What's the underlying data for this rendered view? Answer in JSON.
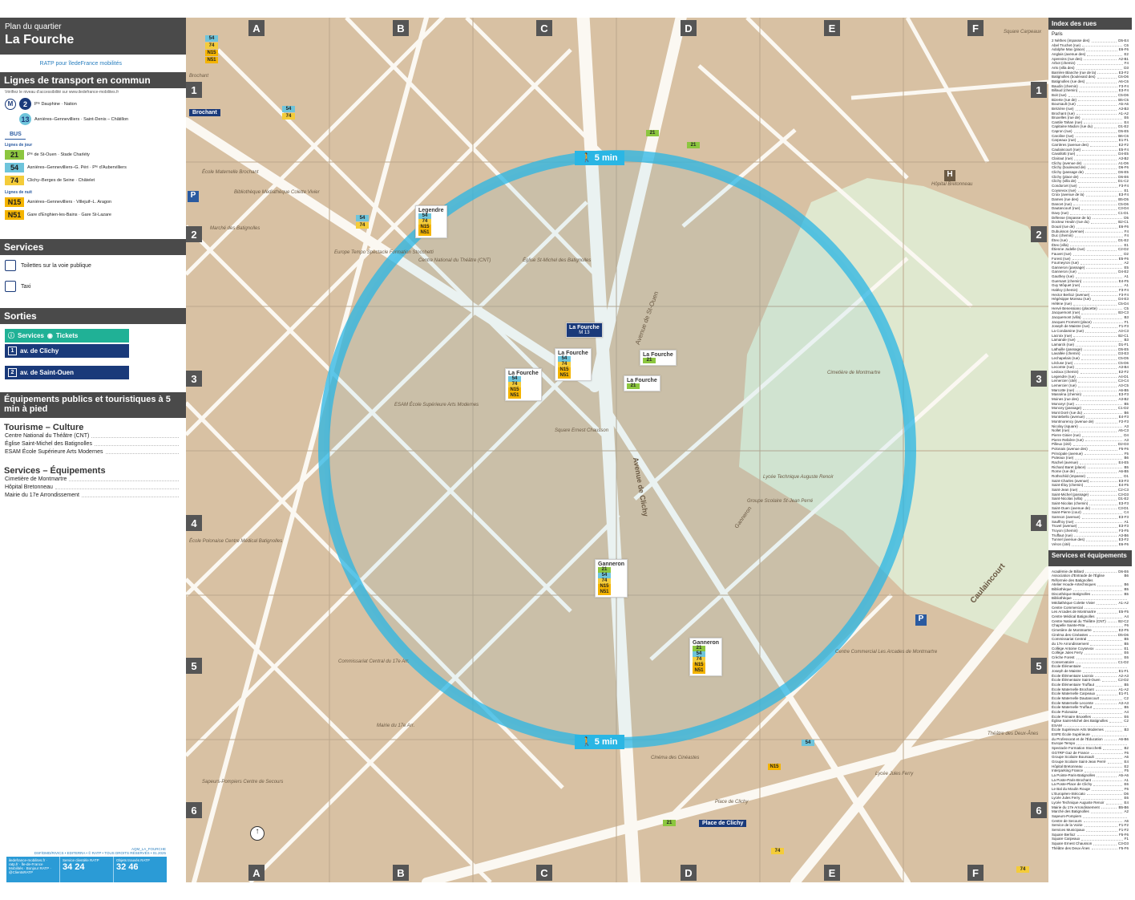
{
  "header": {
    "subtitle": "Plan du quartier",
    "title": "La Fourche",
    "logo_text": "RATP pour îledeFrance mobilités"
  },
  "transport": {
    "heading": "Lignes de transport en commun",
    "note": "Vérifiez le niveau d'accessibilité sur www.iledefrance-mobilites.fr",
    "metro_symbol": "M",
    "metro": [
      {
        "line": "2",
        "color": "#1a3a7a",
        "dest": "Pᵗᵉ Dauphine · Nation"
      },
      {
        "line": "13",
        "color": "#6ec4db",
        "dest": "Asnières–Gennevilliers · Saint-Denis – Châtillon"
      }
    ],
    "bus_label": "BUS",
    "day_label": "Lignes de jour",
    "night_label": "Lignes de nuit",
    "bus_day": [
      {
        "line": "21",
        "color": "#8cc63f",
        "dest": "Pᵗᵉ de St-Ouen · Stade Charléty"
      },
      {
        "line": "54",
        "color": "#6ec4db",
        "dest": "Asnières–Gennevilliers–G. Péri · Pᵗᵉ d'Aubervilliers"
      },
      {
        "line": "74",
        "color": "#f4cc3a",
        "dest": "Clichy–Berges de Seine · Châtelet"
      }
    ],
    "bus_night": [
      {
        "line": "N15",
        "color": "#f4b400",
        "dest": "Asnières–Gennevilliers · Villejuif–L. Aragon"
      },
      {
        "line": "N51",
        "color": "#f4b400",
        "dest": "Gare d'Enghien-les-Bains · Gare St-Lazare"
      }
    ]
  },
  "services": {
    "heading": "Services",
    "items": [
      {
        "label": "Toilettes sur la voie publique"
      },
      {
        "label": "Taxi"
      }
    ]
  },
  "exits": {
    "heading": "Sorties",
    "services_label": "Services",
    "tickets_label": "Tickets",
    "items": [
      {
        "num": "1",
        "label": "av. de Clichy"
      },
      {
        "num": "2",
        "label": "av. de Saint-Ouen"
      }
    ]
  },
  "facilities": {
    "heading": "Équipements publics et touristiques à 5 min à pied",
    "categories": [
      {
        "title": "Tourisme – Culture",
        "items": [
          "Centre National du Théâtre (CNT)",
          "Église Saint-Michel des Batignolles",
          "ESAM École Supérieure Arts Modernes"
        ]
      },
      {
        "title": "Services – Équipements",
        "items": [
          "Cimetière de Montmartre",
          "Hôpital Bretonneau",
          "Mairie du 17e Arrondissement"
        ]
      }
    ]
  },
  "footer": {
    "ref": "AQM_LA_FOURCHE",
    "copyright": "DSF/DMD/RIVICS • EDITERRA • © RATP • TOUS DROITS RÉSERVÉS • 01.2025",
    "col1": "iledefrance-mobilites.fr · ratp.fr · Île-de-France Mobilités · Bonjour RATP · @ClientsRATP",
    "col2_title": "Service clientèle RATP",
    "col2_num": "34 24",
    "col3_title": "Objets trouvés RATP",
    "col3_num": "32 46"
  },
  "map": {
    "columns": [
      "A",
      "B",
      "C",
      "D",
      "E",
      "F"
    ],
    "rows": [
      "1",
      "2",
      "3",
      "4",
      "5",
      "6"
    ],
    "walk_label": "5 min",
    "station_main": "La Fourche",
    "metro_symbol": "M",
    "metro_line": "13",
    "stations": [
      {
        "name": "Legendre",
        "lines": [
          "54",
          "74",
          "N15",
          "N51"
        ]
      },
      {
        "name": "La Fourche",
        "lines": [
          "54",
          "74",
          "N15",
          "N51"
        ]
      },
      {
        "name": "La Fourche",
        "lines": [
          "54",
          "74",
          "N15",
          "N51"
        ]
      },
      {
        "name": "La Fourche",
        "lines": [
          "21"
        ]
      },
      {
        "name": "La Fourche",
        "lines": [
          "21"
        ]
      },
      {
        "name": "Ganneron",
        "lines": [
          "21",
          "54",
          "74",
          "N15",
          "N51"
        ]
      },
      {
        "name": "Ganneron",
        "lines": [
          "21",
          "54",
          "74",
          "N15",
          "N51"
        ]
      }
    ],
    "labels": [
      "Brochant",
      "École Maternelle Brochant",
      "Bibliothèque Médiathèque Colette Vivier",
      "Marché des Batignolles",
      "Europe Tempo Spectacle Formation Stocchetti",
      "Centre National du Théâtre (CNT)",
      "Église St-Michel des Batignolles",
      "Cimetière de Montmartre",
      "ESAM École Supérieure Arts Modernes",
      "Square Ernest Chausson",
      "Groupe Scolaire St-Jean Perré",
      "Centre Commercial Les Arcades de Montmartre",
      "Hôpital Bretonneau",
      "Commissariat Central du 17e Arr.",
      "Mairie du 17e Arr.",
      "Place de Clichy",
      "Lycée Jules Ferry",
      "Théâtre des Deux-Ânes",
      "Cinéma des Cinéastes",
      "Sapeurs-Pompiers Centre de Secours",
      "Square Carpeaux",
      "École Polonaise Centre Médical Batignolles",
      "Avenue de Clichy",
      "Avenue de St-Ouen",
      "Caulaincourt",
      "Ganneron",
      "Lycée Technique Auguste Renoir"
    ],
    "metro_labels": [
      "Brochant",
      "Place de Clichy"
    ]
  },
  "index": {
    "heading": "Index des rues",
    "city": "Paris",
    "streets": [
      [
        "2 Nèthes (impasse des)",
        "D5-E4"
      ],
      [
        "Abel Truchet (rue)",
        "C6"
      ],
      [
        "Adolphe Max (place)",
        "E6-F6"
      ],
      [
        "Anglais (avenue des)",
        "E2"
      ],
      [
        "Apennins (rue des)",
        "A2-B1"
      ],
      [
        "Arbot (chemin)",
        "F4"
      ],
      [
        "Arts (villa des)",
        "D3"
      ],
      [
        "Barrière Blanche (rue de la)",
        "E3-F2"
      ],
      [
        "Batignolles (boulevard des)",
        "C6-D6"
      ],
      [
        "Batignolles (rue des)",
        "A6-C6"
      ],
      [
        "Baudin (chemin)",
        "F3-F4"
      ],
      [
        "Billaud (chemin)",
        "E3-F4"
      ],
      [
        "Boit (rue)",
        "C5-D6"
      ],
      [
        "Bizerte (rue de)",
        "B5-C5"
      ],
      [
        "Boursault (rue)",
        "A5-A6"
      ],
      [
        "Brézière (rue)",
        "A3-B3"
      ],
      [
        "Brochant (rue)",
        "A1-A2"
      ],
      [
        "Bruxelles (rue de)",
        "E6"
      ],
      [
        "Cantile Tahan (rue)",
        "E4"
      ],
      [
        "Capitaine Madon (rue du)",
        "D1-E2"
      ],
      [
        "Capron (rue)",
        "D5-E5"
      ],
      [
        "Caroline (rue)",
        "B6-C6"
      ],
      [
        "Carpeaux (rue)",
        "E1-F1"
      ],
      [
        "Carrières (avenue des)",
        "E2-F2"
      ],
      [
        "Caulaincourt (rue)",
        "E5-F4"
      ],
      [
        "Cavallotti (rue)",
        "D4-E5"
      ],
      [
        "Clairaut (rue)",
        "A3-B2"
      ],
      [
        "Clichy (avenue de)",
        "A1-D6"
      ],
      [
        "Clichy (boulevard de)",
        "D6-F6"
      ],
      [
        "Clichy (passage de)",
        "D6-E5"
      ],
      [
        "Clichy (place de)",
        "D6-E6"
      ],
      [
        "Clichy (villa de)",
        "D1-C2"
      ],
      [
        "Condorcet (rue)",
        "F3-F4"
      ],
      [
        "Coysevox (rue)",
        "E1"
      ],
      [
        "Croix (avenue de la)",
        "E3-F4"
      ],
      [
        "Dames (rue des)",
        "B5-D5"
      ],
      [
        "Dancet (rue)",
        "C5-D6"
      ],
      [
        "Dautancourt (rue)",
        "C3-D4"
      ],
      [
        "Davy (rue)",
        "C1-D1"
      ],
      [
        "Défense (impasse de la)",
        "D5"
      ],
      [
        "Docteur Heulin (rue du)",
        "B2-C1"
      ],
      [
        "Doual (rue de)",
        "E6-F6"
      ],
      [
        "Dubuisson (avenue)",
        "F4"
      ],
      [
        "Duc (chemin)",
        "F4"
      ],
      [
        "Étex (rue)",
        "D1-E2"
      ],
      [
        "Étex (villa)",
        "E1"
      ],
      [
        "Étienne Jodelle (rue)",
        "C2-D2"
      ],
      [
        "Fauvet (rue)",
        "D2"
      ],
      [
        "Forest (rue)",
        "E5-F6"
      ],
      [
        "Fourneyron (rue)",
        "A2"
      ],
      [
        "Ganneron (passage)",
        "E5"
      ],
      [
        "Ganneron (rue)",
        "D4-E2"
      ],
      [
        "Gauthey (rue)",
        "A1"
      ],
      [
        "Guersant (chemin)",
        "E4-F5"
      ],
      [
        "Guy Môquet (rue)",
        "A1"
      ],
      [
        "Halévy (chemin)",
        "F3-F4"
      ],
      [
        "Hector Berlioz (avenue)",
        "F3-F4"
      ],
      [
        "Hégésippe Moreau (rue)",
        "D4-E3"
      ],
      [
        "Hélène (rue)",
        "C5-D4"
      ],
      [
        "Hervé Benessiano (placette)",
        "C5"
      ],
      [
        "Jacquemont (rue)",
        "B3-C3"
      ],
      [
        "Jacquemont (villa)",
        "B3"
      ],
      [
        "Jacques Froment (place)",
        "F1"
      ],
      [
        "Joseph de Maistre (rue)",
        "F1-F3"
      ],
      [
        "La Condamine (rue)",
        "A3-C3"
      ],
      [
        "Lacroix (rue)",
        "B2-C1"
      ],
      [
        "Lamande (rue)",
        "B3"
      ],
      [
        "Lamarck (rue)",
        "D1-F1"
      ],
      [
        "Lathuille (passage)",
        "D5-E5"
      ],
      [
        "Lavallée (chemin)",
        "D3-E3"
      ],
      [
        "Lechapelais (rue)",
        "C5-D5"
      ],
      [
        "Lécluse (rue)",
        "C5-D6"
      ],
      [
        "Lecomte (rue)",
        "A3-B4"
      ],
      [
        "Ledoux (chemin)",
        "E2-F2"
      ],
      [
        "Legendre (rue)",
        "A4-D1"
      ],
      [
        "Lemercier (cité)",
        "C3-C4"
      ],
      [
        "Lemercier (rue)",
        "A3-C5"
      ],
      [
        "Marcotte (rue)",
        "A6-B5"
      ],
      [
        "Masséna (chemin)",
        "E3-F3"
      ],
      [
        "Moines (rue des)",
        "A3-B2"
      ],
      [
        "Monceyr (rue)",
        "B5"
      ],
      [
        "Moncey (passage)",
        "C1-D2"
      ],
      [
        "Mont Doré (rue du)",
        "B6"
      ],
      [
        "Montebello (avenue)",
        "E4-F3"
      ],
      [
        "Montmorency (avenue de)",
        "F2-F3"
      ],
      [
        "Nicolay (square)",
        "A3"
      ],
      [
        "Nollet (rue)",
        "A5-C3"
      ],
      [
        "Pierre Ginier (rue)",
        "D4"
      ],
      [
        "Pierre Rebière (rue)",
        "A3"
      ],
      [
        "Pilleux (cité)",
        "D2-D3"
      ],
      [
        "Polonais (avenue des)",
        "F5-F6"
      ],
      [
        "Principale (avenue)",
        "F5"
      ],
      [
        "Puteaux (rue)",
        "B6"
      ],
      [
        "Rachel (avenue)",
        "E4-E5"
      ],
      [
        "Richard Baret (place)",
        "B5"
      ],
      [
        "Rome (rue de)",
        "A6-B5"
      ],
      [
        "Rothschild (impasse)",
        "D1"
      ],
      [
        "Saint-Charles (avenue)",
        "E3-F3"
      ],
      [
        "Saint-Éloy (chemin)",
        "E4-F5"
      ],
      [
        "Saint-Jean (rue)",
        "C2-C3"
      ],
      [
        "Saint-Michel (passage)",
        "C3-D3"
      ],
      [
        "Saint-Nicolas (villa)",
        "D1-E2"
      ],
      [
        "Saint-Nicolas (chemin)",
        "E3-F3"
      ],
      [
        "Saint-Ouen (avenue de)",
        "C3-D1"
      ],
      [
        "Saint-Pierre (cour)",
        "C4"
      ],
      [
        "Samson (avenue)",
        "E3-F3"
      ],
      [
        "Sauffroy (rue)",
        "A1"
      ],
      [
        "Truvel (avenue)",
        "E3-F3"
      ],
      [
        "Troyon (chemin)",
        "F3-F5"
      ],
      [
        "Truffaut (rue)",
        "A3-B6"
      ],
      [
        "Tunnel (avenue des)",
        "E3-F2"
      ],
      [
        "Véron (cité)",
        "E6-F6"
      ]
    ],
    "services_heading": "Services et équipements",
    "services": [
      [
        "Académie de Billard",
        "D6-E6"
      ],
      [
        "Association d'Entraide de l'Église Réformée des Batignolles",
        "B6"
      ],
      [
        "Atelier Houde-Artechniques",
        "B6"
      ],
      [
        "Bibliothèque",
        "B5"
      ],
      [
        "Discothèque Batignolles",
        "B5"
      ],
      [
        "Bibliothèque",
        ""
      ],
      [
        "Médiathèque Colette Vivier",
        "A1-A2"
      ],
      [
        "Centre Commercial",
        ""
      ],
      [
        "Les Arcades de Montmartre",
        "E5-F5"
      ],
      [
        "Centre Médical Batignolles",
        "A4"
      ],
      [
        "Centre National du Théâtre (CNT)",
        "B2-C2"
      ],
      [
        "Chapelle Sainte-Rita",
        "F6"
      ],
      [
        "Cimetière de Montmartre",
        "E2-F5"
      ],
      [
        "Cinéma des Cinéastes",
        "D5-D6"
      ],
      [
        "Commissariat Central",
        "B5"
      ],
      [
        "du 17e Arrondissement",
        "B5"
      ],
      [
        "Collège Antoine Coysevox",
        "E1"
      ],
      [
        "Collège Jules Ferry",
        "E6"
      ],
      [
        "Crèche Forest",
        "E6"
      ],
      [
        "Conservatoire",
        "C1-D2"
      ],
      [
        "École Élémentaire",
        ""
      ],
      [
        "Joseph de Maistre",
        "E1-F1"
      ],
      [
        "École Élémentaire Lacroix",
        "A2-A3"
      ],
      [
        "École Élémentaire Saint-Ouen",
        "C2-D2"
      ],
      [
        "École Élémentaire Truffaut",
        "B5"
      ],
      [
        "École Maternelle Brochant",
        "A1-A2"
      ],
      [
        "École Maternelle Carpeaux",
        "E1-F1"
      ],
      [
        "École Maternelle Dautancourt",
        "C2"
      ],
      [
        "École Maternelle Lecomte",
        "A3-A3"
      ],
      [
        "École Maternelle Truffaut",
        "B5"
      ],
      [
        "École Polonaise",
        "A4"
      ],
      [
        "École Primaire Bruxelles",
        "E6"
      ],
      [
        "Église Saint-Michel des Batignolles",
        "C2"
      ],
      [
        "ESAM",
        ""
      ],
      [
        "École Supérieure Arts Modernes",
        "B3"
      ],
      [
        "ESPE École Supérieure",
        ""
      ],
      [
        "du Professorat et de l'Éducation",
        "A6-B6"
      ],
      [
        "Europe Tempo",
        ""
      ],
      [
        "Spectacle Formation Stocchetti",
        "B2"
      ],
      [
        "GGTRP Gaz de France",
        "F6"
      ],
      [
        "Groupe Scolaire Boursault",
        "A6"
      ],
      [
        "Groupe Scolaire Saint-Jean Perré",
        "E4"
      ],
      [
        "Hôpital Bretonneau",
        "E2"
      ],
      [
        "Interparking France",
        "F5"
      ],
      [
        "La Pointe-Paris-Batignolles",
        "A5-A6"
      ],
      [
        "La Poste-Paris-Brochant",
        "A1"
      ],
      [
        "La Poste-Place de Clichy",
        "E6"
      ],
      [
        "Le Bal du Moulin Rouge",
        "F6"
      ],
      [
        "L'Européen-Stéccato",
        "D6"
      ],
      [
        "Lycée Jules Ferry",
        "E6"
      ],
      [
        "Lycée Technique Auguste Renoir",
        "E4"
      ],
      [
        "Mairie du 17e Arrondissement",
        "B5-B6"
      ],
      [
        "Marché des Batignolles",
        "A2"
      ],
      [
        "Sapeurs-Pompiers",
        ""
      ],
      [
        "Centre de Secours",
        "A6"
      ],
      [
        "Service de la Voirie",
        "F1-F2"
      ],
      [
        "Services Municipaux",
        "F1-F2"
      ],
      [
        "Square Berlioz",
        "F5-F6"
      ],
      [
        "Square Carpeaux",
        "F1"
      ],
      [
        "Square Ernest Chausson",
        "C3-D3"
      ],
      [
        "Théâtre des Deux-Ânes",
        "F5-F6"
      ]
    ]
  }
}
